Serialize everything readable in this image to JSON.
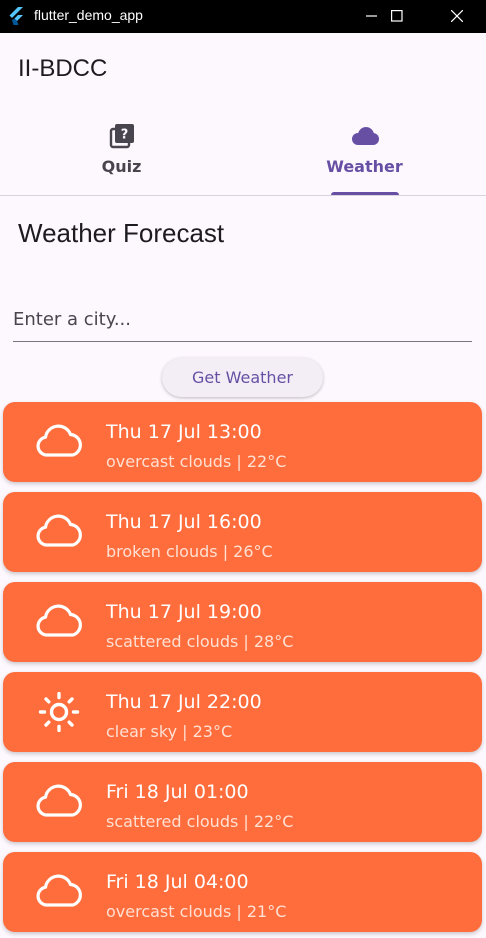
{
  "window": {
    "title": "flutter_demo_app"
  },
  "appbar": {
    "title": "II-BDCC"
  },
  "tabs": [
    {
      "label": "Quiz",
      "icon": "quiz-icon",
      "selected": false
    },
    {
      "label": "Weather",
      "icon": "cloud-icon",
      "selected": true
    }
  ],
  "main": {
    "heading": "Weather Forecast",
    "city_input": {
      "value": "",
      "placeholder": "Enter a city..."
    },
    "button_label": "Get Weather"
  },
  "forecast": [
    {
      "time": "Thu 17 Jul 13:00",
      "desc": "overcast clouds | 22°C",
      "icon": "cloud-icon"
    },
    {
      "time": "Thu 17 Jul 16:00",
      "desc": "broken clouds | 26°C",
      "icon": "cloud-icon"
    },
    {
      "time": "Thu 17 Jul 19:00",
      "desc": "scattered clouds | 28°C",
      "icon": "cloud-icon"
    },
    {
      "time": "Thu 17 Jul 22:00",
      "desc": "clear sky | 23°C",
      "icon": "sun-icon"
    },
    {
      "time": "Fri 18 Jul 01:00",
      "desc": "scattered clouds | 22°C",
      "icon": "cloud-icon"
    },
    {
      "time": "Fri 18 Jul 04:00",
      "desc": "overcast clouds | 21°C",
      "icon": "cloud-icon"
    }
  ],
  "colors": {
    "accent": "#6750a4",
    "card": "#ff6d3d",
    "background": "#fdf7fe"
  }
}
